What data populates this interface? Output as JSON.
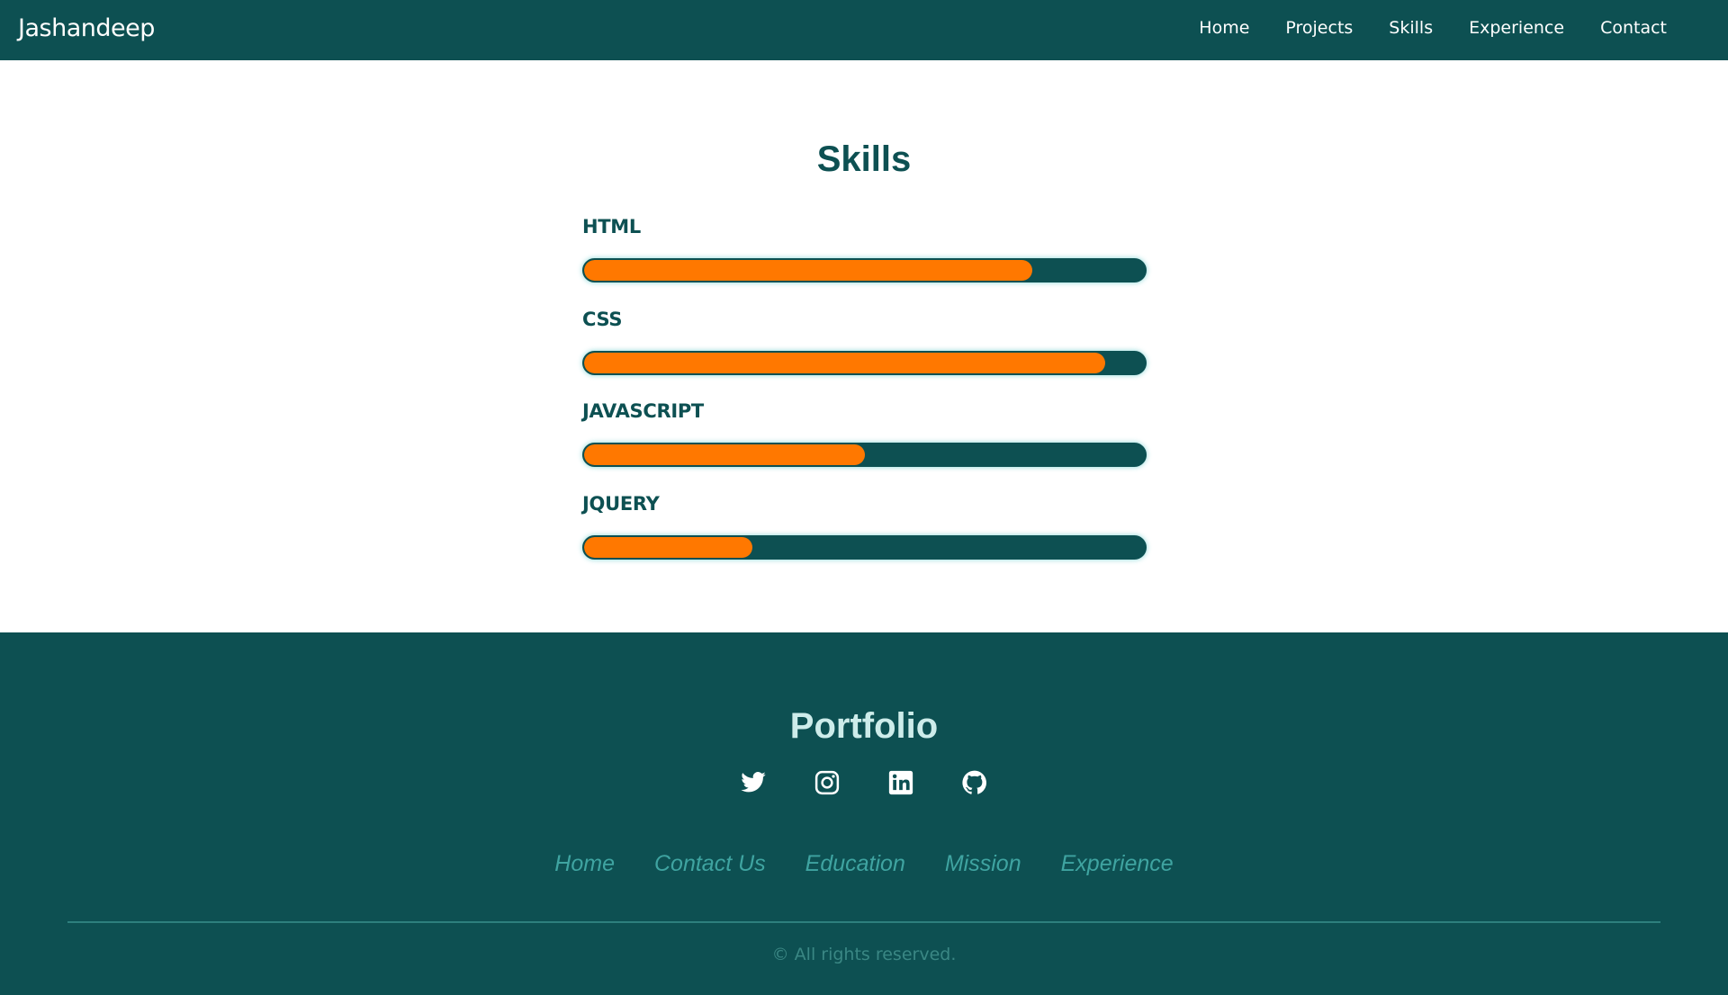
{
  "navbar": {
    "brand": "Jashandeep",
    "links": [
      "Home",
      "Projects",
      "Skills",
      "Experience",
      "Contact"
    ]
  },
  "skills": {
    "title": "Skills",
    "items": [
      {
        "label": "HTML",
        "level": 0.8
      },
      {
        "label": "CSS",
        "level": 0.93
      },
      {
        "label": "JAVASCRIPT",
        "level": 0.5
      },
      {
        "label": "JQUERY",
        "level": 0.3
      }
    ]
  },
  "footer": {
    "title": "Portfolio",
    "socials": [
      "twitter-icon",
      "instagram-icon",
      "linkedin-icon",
      "github-icon"
    ],
    "links": [
      "Home",
      "Contact Us",
      "Education",
      "Mission",
      "Experience"
    ],
    "copyright": "© All rights reserved."
  },
  "colors": {
    "primary": "#0d5052",
    "accent": "#ff7800",
    "footer_title": "#cdecea",
    "footer_link": "#3fa4a1"
  }
}
